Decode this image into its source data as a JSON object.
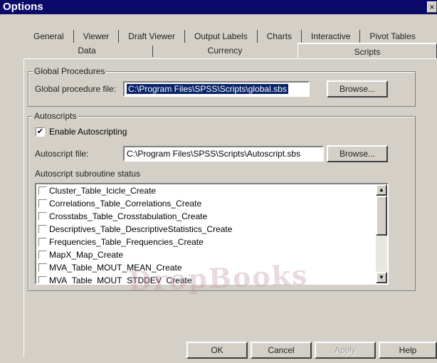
{
  "window": {
    "title": "Options",
    "close_label": "×"
  },
  "tabs": {
    "row1": [
      "General",
      "Viewer",
      "Draft Viewer",
      "Output Labels",
      "Charts",
      "Interactive",
      "Pivot Tables"
    ],
    "row2": [
      "Data",
      "Currency",
      "Scripts"
    ],
    "active": "Scripts"
  },
  "global_procedures": {
    "group_label": "Global Procedures",
    "file_label": "Global procedure file:",
    "file_value": "C:\\Program Files\\SPSS\\Scripts\\global.sbs",
    "browse_label": "Browse..."
  },
  "autoscripts": {
    "group_label": "Autoscripts",
    "enable_label": "Enable Autoscripting",
    "enable_checked": true,
    "file_label": "Autoscript file:",
    "file_value": "C:\\Program Files\\SPSS\\Scripts\\Autoscript.sbs",
    "browse_label": "Browse...",
    "status_label": "Autoscript subroutine status",
    "subroutines": [
      {
        "name": "Cluster_Table_Icicle_Create",
        "checked": false
      },
      {
        "name": "Correlations_Table_Correlations_Create",
        "checked": false
      },
      {
        "name": "Crosstabs_Table_Crosstabulation_Create",
        "checked": false
      },
      {
        "name": "Descriptives_Table_DescriptiveStatistics_Create",
        "checked": false
      },
      {
        "name": "Frequencies_Table_Frequencies_Create",
        "checked": false
      },
      {
        "name": "MapX_Map_Create",
        "checked": false
      },
      {
        "name": "MVA_Table_MOUT_MEAN_Create",
        "checked": false
      },
      {
        "name": "MVA_Table_MOUT_STDDEV_Create",
        "checked": false
      }
    ]
  },
  "buttons": {
    "ok": "OK",
    "cancel": "Cancel",
    "apply": "Apply",
    "help": "Help"
  },
  "watermark": "DropBooks"
}
